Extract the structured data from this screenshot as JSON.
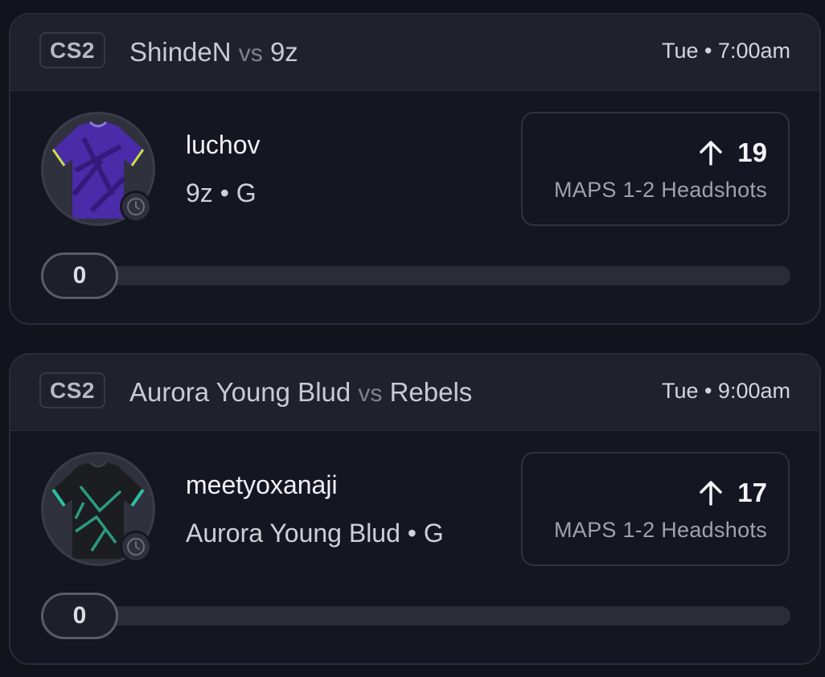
{
  "cards": [
    {
      "league": "CS2",
      "team_a": "ShindeN",
      "vs": "vs",
      "team_b": "9z",
      "time": "Tue • 7:00am",
      "player_name": "luchov",
      "player_meta": "9z • G",
      "direction": "up-arrow-icon",
      "line_value": "19",
      "stat_label": "MAPS 1-2 Headshots",
      "progress_value": "0",
      "progress_fraction": 0,
      "jersey_icon": "jersey-icon",
      "jersey_color": "#4a2ba8"
    },
    {
      "league": "CS2",
      "team_a": "Aurora Young Blud",
      "vs": "vs",
      "team_b": "Rebels",
      "time": "Tue • 9:00am",
      "player_name": "meetyoxanaji",
      "player_meta": "Aurora Young Blud • G",
      "direction": "up-arrow-icon",
      "line_value": "17",
      "stat_label": "MAPS 1-2 Headshots",
      "progress_value": "0",
      "progress_fraction": 0,
      "jersey_icon": "jersey-icon",
      "jersey_color": "#1b1d20"
    }
  ]
}
